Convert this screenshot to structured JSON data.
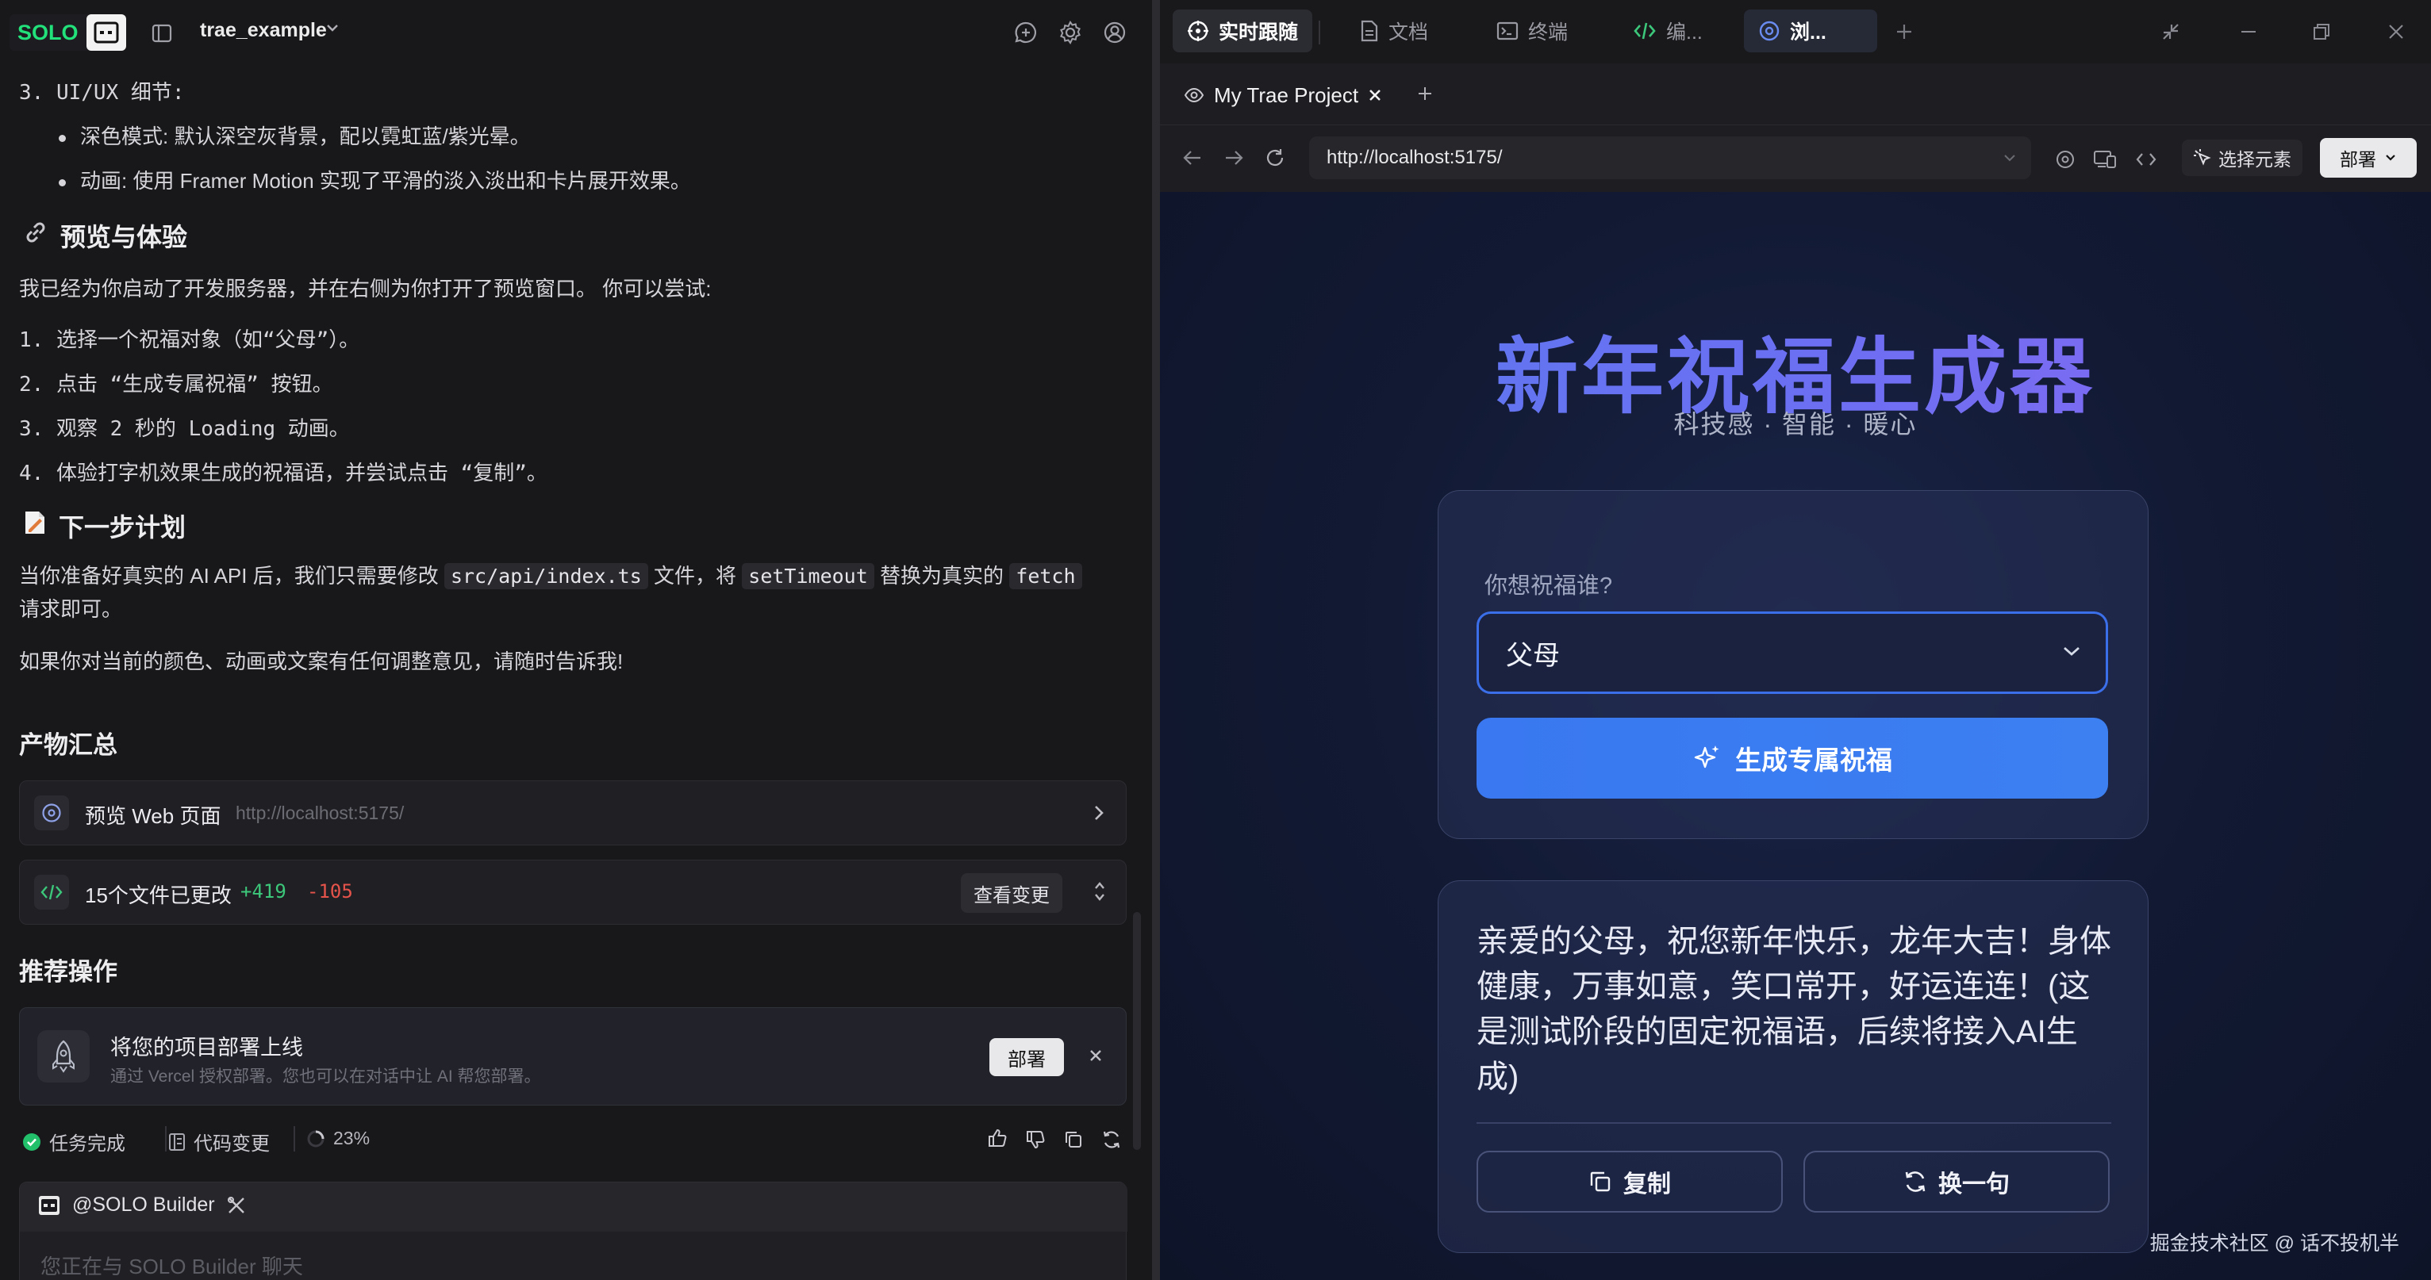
{
  "left": {
    "logo_text": "SOLO",
    "project_name": "trae_example",
    "uiux_heading": "3. UI/UX 细节:",
    "bullets": [
      "深色模式: 默认深空灰背景，配以霓虹蓝/紫光晕。",
      "动画: 使用 Framer Motion 实现了平滑的淡入淡出和卡片展开效果。"
    ],
    "preview_heading": "预览与体验",
    "preview_intro": "我已经为你启动了开发服务器，并在右侧为你打开了预览窗口。 你可以尝试:",
    "steps": [
      "1. 选择一个祝福对象（如“父母”）。",
      "2. 点击 “生成专属祝福” 按钮。",
      "3. 观察 2 秒的 Loading 动画。",
      "4. 体验打字机效果生成的祝福语，并尝试点击 “复制”。"
    ],
    "next_heading": "下一步计划",
    "next_p1_a": "当你准备好真实的 AI API 后，我们只需要修改",
    "next_p1_code1": "src/api/index.ts",
    "next_p1_b": "文件，将",
    "next_p1_code2": "setTimeout",
    "next_p1_c": "替换为真实的",
    "next_p1_code3": "fetch",
    "next_p1_d": "请求即可。",
    "next_p2": "如果你对当前的颜色、动画或文案有任何调整意见，请随时告诉我!",
    "artifacts_heading": "产物汇总",
    "preview_card_label": "预览 Web 页面",
    "preview_card_url": "http://localhost:5175/",
    "files_changed": "15个文件已更改",
    "additions": "+419",
    "deletions": "-105",
    "view_changes": "查看变更",
    "recommend_heading": "推荐操作",
    "deploy_title": "将您的项目部署上线",
    "deploy_desc": "通过 Vercel 授权部署。您也可以在对话中让 AI 帮您部署。",
    "deploy_button": "部署",
    "status_done": "任务完成",
    "status_code": "代码变更",
    "status_progress": "23%",
    "chat_agent": "@SOLO Builder",
    "chat_placeholder": "您正在与 SOLO Builder 聊天"
  },
  "right": {
    "tabs": [
      "实时跟随",
      "文档",
      "终端",
      "编...",
      "浏..."
    ],
    "page_tab": "My Trae Project",
    "url": "http://localhost:5175/",
    "pick_element": "选择元素",
    "deploy": "部署",
    "app": {
      "title": "新年祝福生成器",
      "subtitle": "科技感 · 智能 · 暖心",
      "select_label": "你想祝福谁?",
      "select_value": "父母",
      "generate_button": "生成专属祝福",
      "message": "亲爱的父母，祝您新年快乐，龙年大吉！身体健康，万事如意，笑口常开，好运连连！(这是测试阶段的固定祝福语，后续将接入AI生成)",
      "copy_button": "复制",
      "another_button": "换一句"
    },
    "watermark": "掘金技术社区 @ 话不投机半"
  },
  "colors": {
    "solo_green": "#22e07a",
    "accent_blue": "#3978f0",
    "addition_green": "#3cc77a",
    "deletion_red": "#e5534b"
  }
}
